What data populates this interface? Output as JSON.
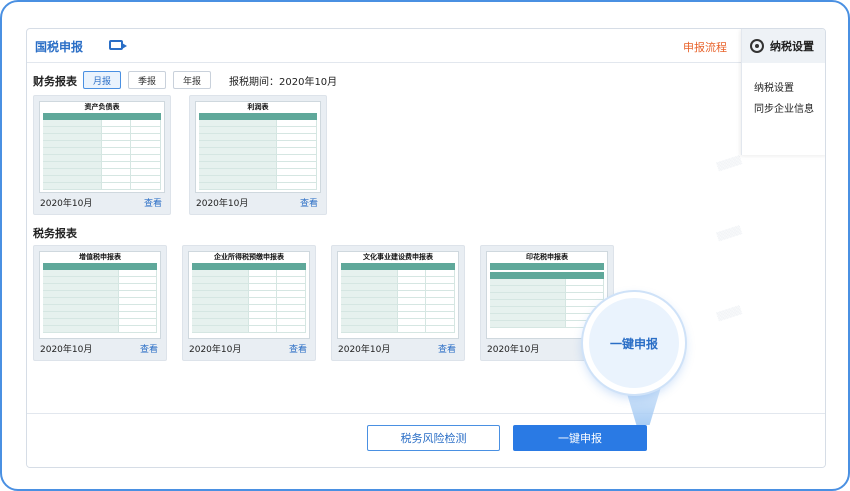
{
  "header": {
    "title": "国税申报",
    "flow_link": "申报流程"
  },
  "settings": {
    "title": "纳税设置",
    "items": [
      "纳税设置",
      "同步企业信息"
    ]
  },
  "financial": {
    "label": "财务报表",
    "tabs": [
      "月报",
      "季报",
      "年报"
    ],
    "period": "报税期间：2020年10月",
    "cards": [
      {
        "title": "资产负债表",
        "date": "2020年10月",
        "view": "查看"
      },
      {
        "title": "利润表",
        "date": "2020年10月",
        "view": "查看"
      }
    ]
  },
  "tax": {
    "label": "税务报表",
    "cards": [
      {
        "title": "增值税申报表",
        "date": "2020年10月",
        "view": "查看"
      },
      {
        "title": "企业所得税预缴申报表",
        "date": "2020年10月",
        "view": "查看"
      },
      {
        "title": "文化事业建设费申报表",
        "date": "2020年10月",
        "view": "查看"
      },
      {
        "title": "印花税申报表",
        "date": "2020年10月",
        "view": ""
      }
    ]
  },
  "highlight": {
    "label": "一键申报"
  },
  "actions": {
    "risk_label": "税务风险检测",
    "file_label": "一键申报"
  }
}
